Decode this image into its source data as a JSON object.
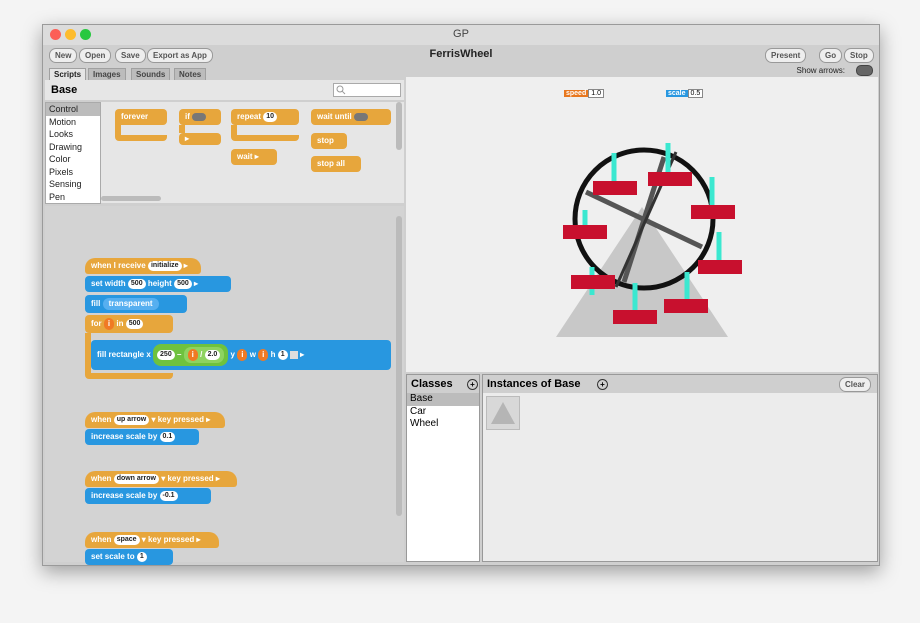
{
  "window": {
    "title": "GP",
    "project_title": "FerrisWheel"
  },
  "toolbar": {
    "new": "New",
    "open": "Open",
    "save": "Save",
    "export": "Export as App",
    "present": "Present",
    "go": "Go",
    "stop": "Stop",
    "show_arrows": "Show arrows:"
  },
  "tabs": [
    "Scripts",
    "Images",
    "Sounds",
    "Notes"
  ],
  "palette": {
    "class_name": "Base",
    "categories": [
      "Control",
      "Motion",
      "Looks",
      "Drawing",
      "Color",
      "Pixels",
      "Sensing",
      "Pen"
    ],
    "blocks": {
      "forever": "forever",
      "if": "if",
      "repeat": "repeat",
      "repeat_count": "10",
      "wait": "wait",
      "wait_until": "wait until",
      "stop": "stop",
      "stop_all": "stop all"
    }
  },
  "scripts": {
    "s1": {
      "when_i_receive": "when I receive",
      "msg": "initialize",
      "set_width": "set width",
      "width": "500",
      "height_label": "height",
      "height": "500",
      "fill": "fill",
      "transparent": "transparent",
      "for": "for",
      "i": "i",
      "in": "in",
      "in_val": "500",
      "fill_rect": "fill rectangle x",
      "x_val": "250",
      "minus": "–",
      "div": "/",
      "div_val": "2.0",
      "y": "y",
      "w": "w",
      "h": "h",
      "h_val": "1"
    },
    "s2": {
      "when": "when",
      "key": "up arrow",
      "key_pressed": "key pressed",
      "action": "increase scale by",
      "val": "0.1"
    },
    "s3": {
      "when": "when",
      "key": "down arrow",
      "key_pressed": "key pressed",
      "action": "increase scale by",
      "val": "-0.1"
    },
    "s4": {
      "when": "when",
      "key": "space",
      "key_pressed": "key pressed",
      "action": "set scale to",
      "val": "1"
    }
  },
  "stage": {
    "watchers": [
      {
        "name": "speed",
        "value": "1.0",
        "color": "#e8771e"
      },
      {
        "name": "scale",
        "value": "0.5",
        "color": "#2897e0"
      }
    ]
  },
  "classes": {
    "title": "Classes",
    "items": [
      "Base",
      "Car",
      "Wheel"
    ]
  },
  "instances": {
    "title": "Instances of Base",
    "clear": "Clear"
  },
  "colors": {
    "orange_block": "#e7a63c",
    "blue_block": "#2897e0",
    "green_block": "#6fc23e",
    "car_red": "#c8102e",
    "spoke_cyan": "#3be8d0"
  }
}
